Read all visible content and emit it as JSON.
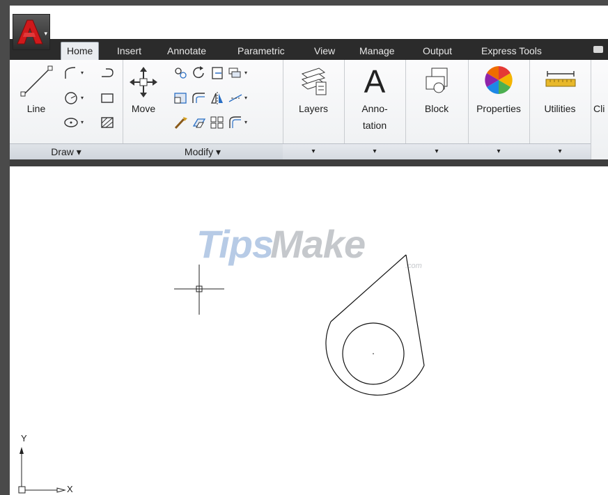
{
  "app": {
    "logo_letter": "A"
  },
  "tabs": [
    {
      "label": "Home",
      "active": true
    },
    {
      "label": "Insert"
    },
    {
      "label": "Annotate"
    },
    {
      "label": "Parametric"
    },
    {
      "label": "View"
    },
    {
      "label": "Manage"
    },
    {
      "label": "Output"
    },
    {
      "label": "Express Tools"
    }
  ],
  "ribbon": {
    "draw": {
      "line_label": "Line",
      "title": "Draw ▾"
    },
    "modify": {
      "move_label": "Move",
      "title": "Modify ▾"
    },
    "layers": {
      "label": "Layers"
    },
    "annotation": {
      "glyph": "A",
      "label_line1": "Anno-",
      "label_line2": "tation"
    },
    "block": {
      "label": "Block"
    },
    "properties": {
      "label": "Properties"
    },
    "utilities": {
      "label": "Utilities"
    },
    "clip": {
      "label": "Cli"
    },
    "dropdown_glyph": "▾"
  },
  "watermark": {
    "part1": "Tips",
    "part2": "Make",
    "part3": ".com"
  },
  "ucs": {
    "x_label": "X",
    "y_label": "Y"
  },
  "colors": {
    "tab_bar": "#2b2b2b",
    "frame": "#4a4a4a",
    "logo_red": "#d0191b"
  }
}
